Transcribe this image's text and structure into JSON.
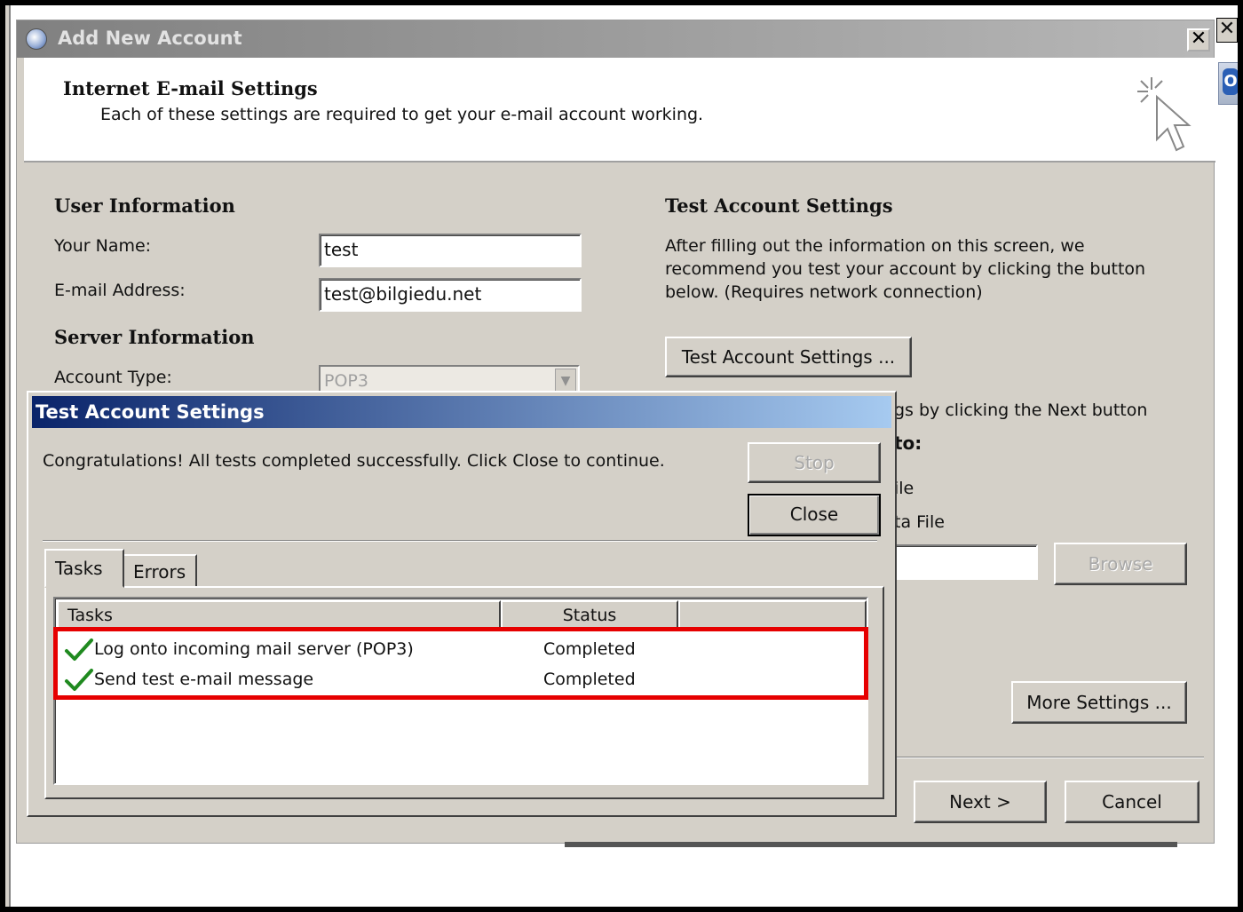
{
  "dialog": {
    "title": "Add New Account",
    "close_glyph": "✕",
    "header_title": "Internet E-mail Settings",
    "header_subtitle": "Each of these settings are required to get your e-mail account working.",
    "header_icon": "cursor-click-icon"
  },
  "user_info": {
    "heading": "User Information",
    "name_label": "Your Name:",
    "name_value": "test",
    "email_label": "E-mail Address:",
    "email_value": "test@bilgiedu.net"
  },
  "server_info": {
    "heading": "Server Information",
    "account_type_label": "Account Type:",
    "account_type_value": "POP3"
  },
  "test_settings": {
    "heading": "Test Account Settings",
    "description": "After filling out the information on this screen, we recommend you test your account by clicking the button below. (Requires network connection)",
    "button": "Test Account Settings ...",
    "partial_next_text": "gs by clicking the Next button",
    "partial_to": "to:",
    "partial_file": "ile",
    "partial_data_file": "ta File",
    "browse_button": "Browse",
    "more_settings_button": "More Settings ..."
  },
  "footer": {
    "next_button": "Next >",
    "cancel_button": "Cancel"
  },
  "popup": {
    "title": "Test Account Settings",
    "message": "Congratulations! All tests completed successfully. Click Close to continue.",
    "stop_button": "Stop",
    "close_button": "Close",
    "tabs": [
      {
        "label": "Tasks"
      },
      {
        "label": "Errors"
      }
    ],
    "columns": [
      "Tasks",
      "Status"
    ],
    "rows": [
      {
        "task": "Log onto incoming mail server (POP3)",
        "status": "Completed"
      },
      {
        "task": "Send test e-mail message",
        "status": "Completed"
      }
    ]
  },
  "background_window": {
    "close_glyph": "✕",
    "app_icon_letter": "O"
  },
  "colors": {
    "highlight_border": "#e60000",
    "checkmark": "#1f8a1f",
    "popup_title_gradient_start": "#0a246a",
    "popup_title_gradient_end": "#a6caf0"
  }
}
